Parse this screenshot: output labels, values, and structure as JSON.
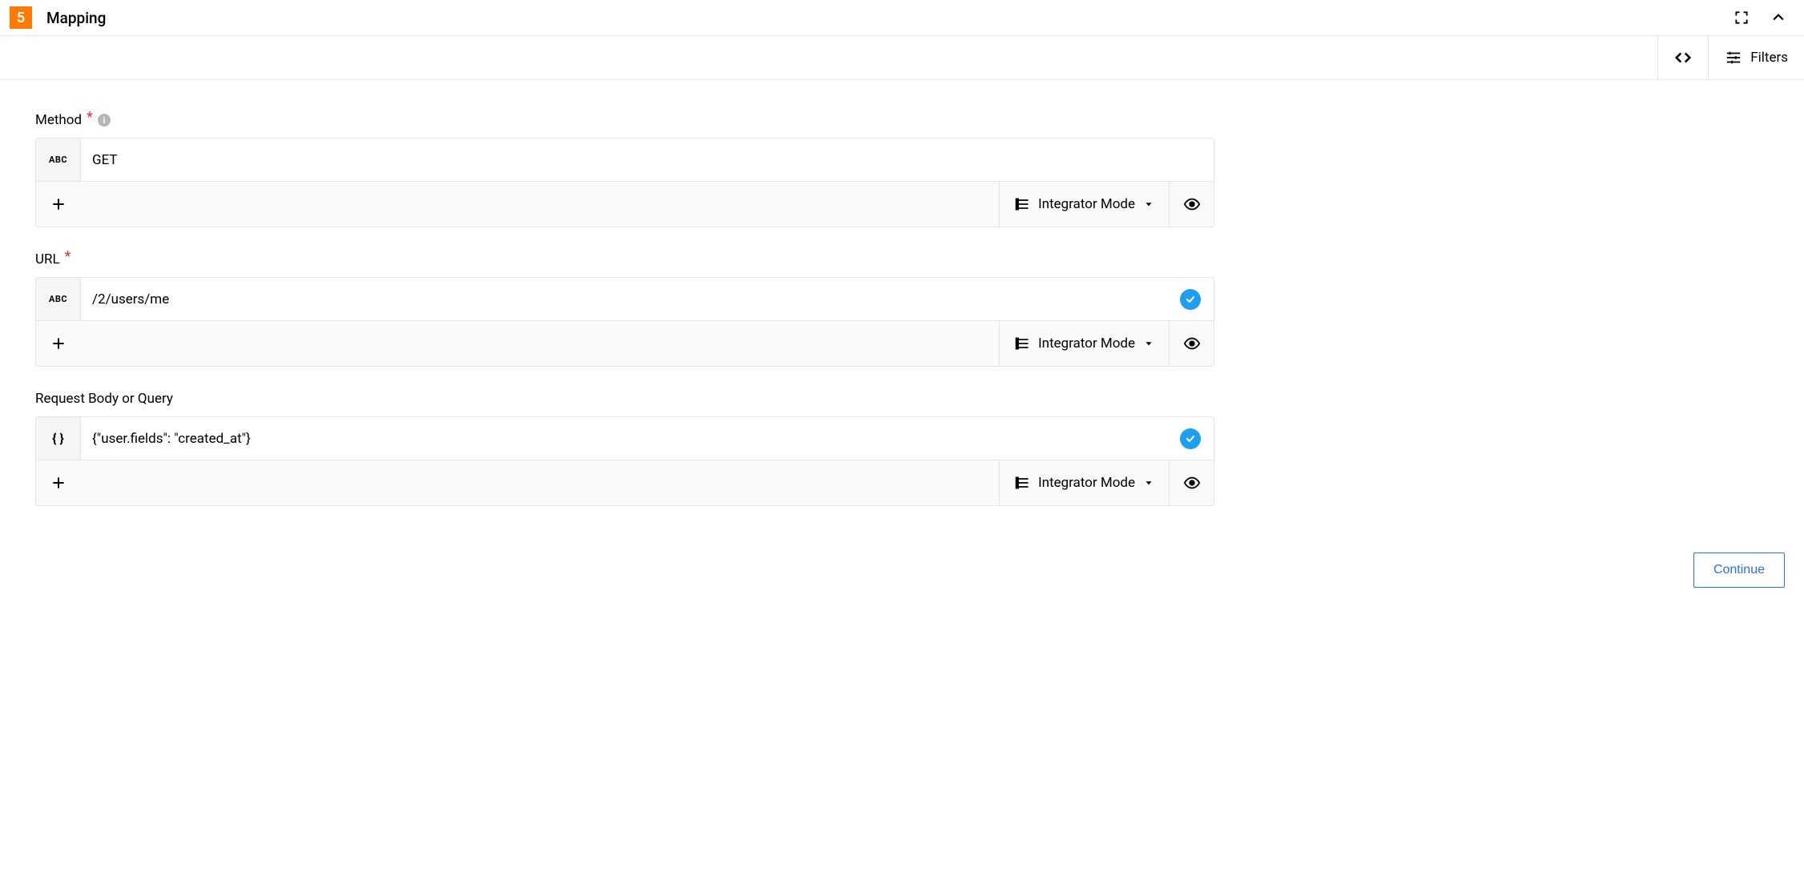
{
  "header": {
    "step_number": "5",
    "title": "Mapping"
  },
  "toolbar": {
    "filters_label": "Filters"
  },
  "fields": {
    "method": {
      "label": "Method",
      "required": true,
      "has_info": true,
      "type_chip": "ABC",
      "value": "GET",
      "has_check": false,
      "mode_label": "Integrator Mode"
    },
    "url": {
      "label": "URL",
      "required": true,
      "has_info": false,
      "type_chip": "ABC",
      "value": "/2/users/me",
      "has_check": true,
      "mode_label": "Integrator Mode"
    },
    "body": {
      "label": "Request Body or Query",
      "required": false,
      "has_info": false,
      "type_chip": "{ }",
      "value": "{\"user.fields\": \"created_at\"}",
      "has_check": true,
      "mode_label": "Integrator Mode"
    }
  },
  "footer": {
    "continue_label": "Continue"
  }
}
